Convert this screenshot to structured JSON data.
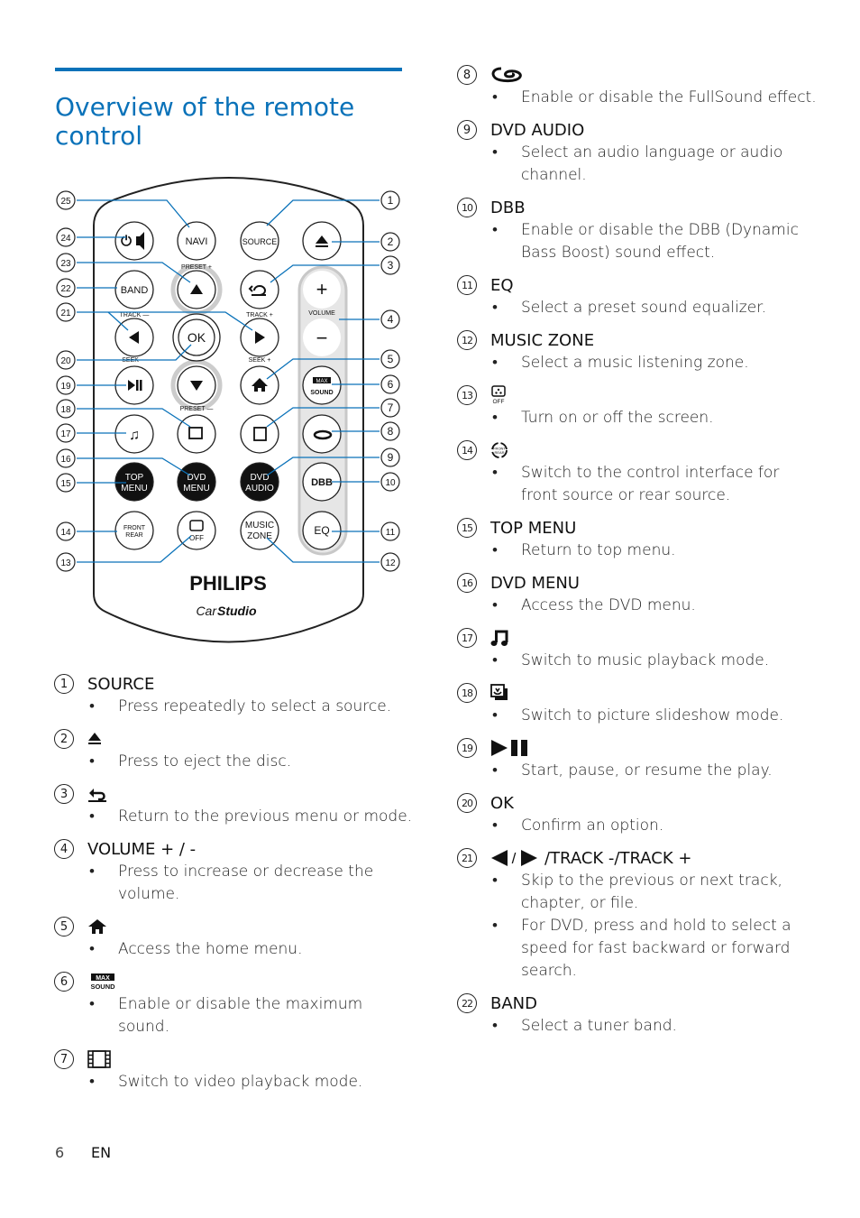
{
  "page": {
    "title": "Overview of the remote control",
    "page_number": "6",
    "language": "EN",
    "accent_color": "#0a72b9"
  },
  "remote": {
    "brand": "PHILIPS",
    "sub_brand_1": "Car",
    "sub_brand_2": "Studio",
    "buttons": {
      "navi": "NAVI",
      "source": "SOURCE",
      "band": "BAND",
      "ok": "OK",
      "top_menu_1": "TOP",
      "top_menu_2": "MENU",
      "dvd_menu_1": "DVD",
      "dvd_menu_2": "MENU",
      "dvd_audio_1": "DVD",
      "dvd_audio_2": "AUDIO",
      "dbb": "DBB",
      "eq": "EQ",
      "music_zone_1": "MUSIC",
      "music_zone_2": "ZONE",
      "front": "FRONT",
      "rear": "REAR",
      "off": "OFF",
      "max": "MAX",
      "sound": "SOUND"
    },
    "labels": {
      "preset_plus": "PRESET +",
      "preset_minus": "PRESET —",
      "track_minus": "TRACK —",
      "track_plus": "TRACK +",
      "seek_minus": "SEEK —",
      "seek_plus": "SEEK +",
      "volume": "VOLUME"
    },
    "callouts": [
      "1",
      "2",
      "3",
      "4",
      "5",
      "6",
      "7",
      "8",
      "9",
      "10",
      "11",
      "12",
      "13",
      "14",
      "15",
      "16",
      "17",
      "18",
      "19",
      "20",
      "21",
      "22",
      "23",
      "24",
      "25"
    ]
  },
  "items": [
    {
      "num": "1",
      "label": "SOURCE",
      "icon": null,
      "bullets": [
        "Press repeatedly to select a source."
      ]
    },
    {
      "num": "2",
      "label": "",
      "icon": "eject-icon",
      "bullets": [
        "Press to eject the disc."
      ]
    },
    {
      "num": "3",
      "label": "",
      "icon": "back-icon",
      "bullets": [
        "Return to the previous menu or mode."
      ]
    },
    {
      "num": "4",
      "label": "VOLUME + / -",
      "icon": null,
      "bullets": [
        "Press to increase or decrease the volume."
      ]
    },
    {
      "num": "5",
      "label": "",
      "icon": "home-icon",
      "bullets": [
        "Access the home menu."
      ]
    },
    {
      "num": "6",
      "label": "",
      "icon": "max-sound-icon",
      "bullets": [
        "Enable or disable the maximum sound."
      ]
    },
    {
      "num": "7",
      "label": "",
      "icon": "film-icon",
      "bullets": [
        "Switch to video playback mode."
      ]
    },
    {
      "num": "8",
      "label": "",
      "icon": "fullsound-icon",
      "bullets": [
        "Enable or disable the FullSound effect."
      ]
    },
    {
      "num": "9",
      "label": "DVD AUDIO",
      "icon": null,
      "bullets": [
        "Select an audio language or audio channel."
      ]
    },
    {
      "num": "10",
      "label": "DBB",
      "icon": null,
      "bullets": [
        "Enable or disable the DBB (Dynamic Bass Boost) sound effect."
      ]
    },
    {
      "num": "11",
      "label": "EQ",
      "icon": null,
      "bullets": [
        "Select a preset sound equalizer."
      ]
    },
    {
      "num": "12",
      "label": "MUSIC ZONE",
      "icon": null,
      "bullets": [
        "Select a music listening zone."
      ]
    },
    {
      "num": "13",
      "label": "",
      "icon": "screen-off-icon",
      "bullets": [
        "Turn on or off the screen."
      ]
    },
    {
      "num": "14",
      "label": "",
      "icon": "front-rear-icon",
      "bullets": [
        "Switch to the control interface for front source or rear source."
      ]
    },
    {
      "num": "15",
      "label": "TOP MENU",
      "icon": null,
      "bullets": [
        "Return to top menu."
      ]
    },
    {
      "num": "16",
      "label": "DVD MENU",
      "icon": null,
      "bullets": [
        "Access the DVD menu."
      ]
    },
    {
      "num": "17",
      "label": "",
      "icon": "music-note-icon",
      "bullets": [
        "Switch to music playback mode."
      ]
    },
    {
      "num": "18",
      "label": "",
      "icon": "picture-icon",
      "bullets": [
        "Switch to picture slideshow mode."
      ]
    },
    {
      "num": "19",
      "label": "",
      "icon": "play-pause-icon",
      "bullets": [
        "Start, pause, or resume the play."
      ]
    },
    {
      "num": "20",
      "label": "OK",
      "icon": null,
      "bullets": [
        "Confirm an option."
      ]
    },
    {
      "num": "21",
      "label": "/TRACK -/TRACK +",
      "icon": "prev-next-icon",
      "bullets": [
        "Skip to the previous or next track, chapter, or file.",
        "For DVD, press and hold to select a speed for fast backward or forward search."
      ]
    },
    {
      "num": "22",
      "label": "BAND",
      "icon": null,
      "bullets": [
        "Select a tuner band."
      ]
    }
  ],
  "bullet_char": "•"
}
